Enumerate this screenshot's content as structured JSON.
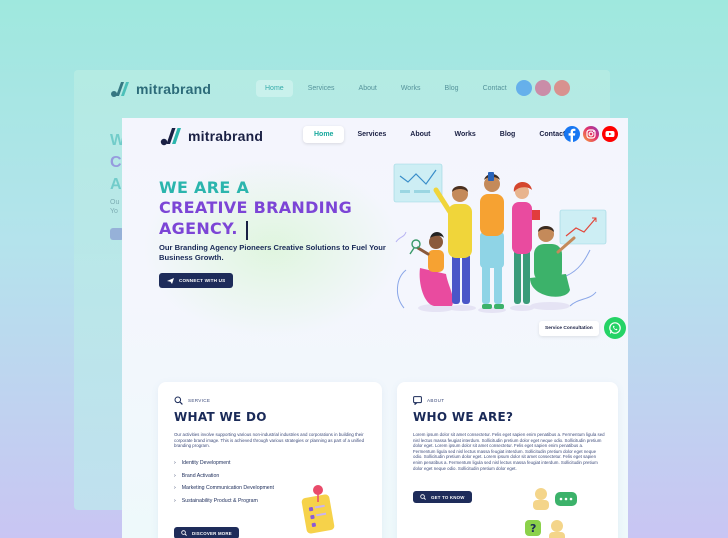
{
  "brand": {
    "name": "mitrabrand",
    "mark_color_a": "#1a2044",
    "mark_color_b": "#2bb5ad"
  },
  "nav": [
    {
      "label": "Home",
      "active": true
    },
    {
      "label": "Services",
      "active": false
    },
    {
      "label": "About",
      "active": false
    },
    {
      "label": "Works",
      "active": false
    },
    {
      "label": "Blog",
      "active": false
    },
    {
      "label": "Contact",
      "active": false
    }
  ],
  "social": [
    {
      "icon": "facebook-icon",
      "color": "#1877f2"
    },
    {
      "icon": "instagram-icon",
      "color": "#e1306c"
    },
    {
      "icon": "youtube-icon",
      "color": "#ff0000"
    }
  ],
  "back_window": {
    "brand": "mitrabrand",
    "nav": [
      "Home",
      "Services",
      "About",
      "Works",
      "Blog",
      "Contact"
    ],
    "hero_letters": [
      "W",
      "C",
      "A"
    ],
    "sub_letters": [
      "Ou",
      "Yo"
    ]
  },
  "hero": {
    "line1": "WE ARE A",
    "line2": "CREATIVE BRANDING",
    "line3": "AGENCY.",
    "subtitle": "Our Branding Agency Pioneers Creative Solutions to Fuel Your Business Growth.",
    "cta_label": "CONNECT WITH US"
  },
  "consultation": {
    "label": "Service Consultation",
    "icon": "whatsapp-icon"
  },
  "service_card": {
    "kicker": "SERVICE",
    "title": "WHAT WE DO",
    "description": "Our activities involve supporting various non-industrial industries and corporations in building their corporate brand image. This is achieved through various strategies or planning as part of a unified branding program.",
    "items": [
      "Identity Development",
      "Brand Activation",
      "Marketing Communication Development",
      "Sustainability Product & Program"
    ],
    "button_label": "DISCOVER MORE"
  },
  "about_card": {
    "kicker": "ABOUT",
    "title": "WHO WE ARE?",
    "description": "Lorem ipsum dolor sit amet consectetur. Felis eget sapien enim penatibus a. Fermentum ligula sed nisl lectus massa feugiat interdum. Sollicitudin pretium dolor eget neque odio. Sollicitudin pretium dolor eget. Lorem ipsum dolor sit amet consectetur. Felis eget sapien enim penatibus a. Fermentum ligula sed nisl lectus massa feugiat interdum. Sollicitudin pretium dolor eget neque odio. Sollicitudin pretium dolor eget. Lorem ipsum dolor sit amet consectetur. Felis eget sapien enim penatibus a. Fermentum ligula sed nisl lectus massa feugiat interdum. Sollicitudin pretium dolor eget neque odio. Sollicitudin pretium dolor eget.",
    "button_label": "GET TO KNOW"
  },
  "colors": {
    "teal": "#2bb5ad",
    "purple": "#7c45d6",
    "navy": "#1e2c5a",
    "whatsapp": "#25d366"
  }
}
